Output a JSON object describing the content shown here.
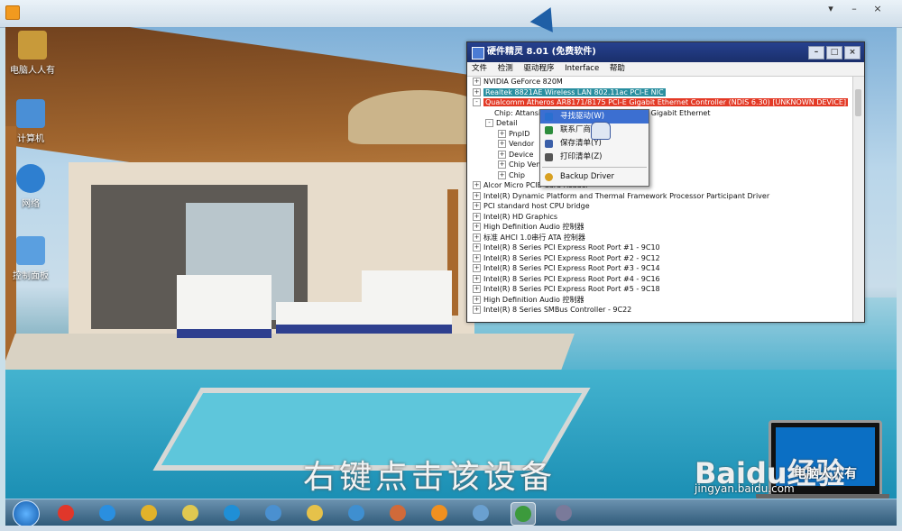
{
  "frame": {
    "controls": [
      "▾",
      "–",
      "×"
    ]
  },
  "desktop": {
    "icons": [
      {
        "label": "电脑人人有",
        "color": "#c89a3a"
      },
      {
        "label": "计算机",
        "color": "#4a8fd6"
      },
      {
        "label": "网络",
        "color": "#2e7fd0"
      },
      {
        "label": "控制面板",
        "color": "#5a9fe0"
      }
    ],
    "caption": "右键点击该设备"
  },
  "window": {
    "title": "硬件精灵 8.01 (免费软件)",
    "controls": [
      "–",
      "□",
      "×"
    ],
    "menu": [
      "文件",
      "检测",
      "驱动程序",
      "Interface",
      "帮助"
    ],
    "tree": [
      {
        "indent": 0,
        "toggle": "+",
        "text": "NVIDIA GeForce 820M",
        "style": ""
      },
      {
        "indent": 0,
        "toggle": "+",
        "text": "Realtek 8821AE Wireless LAN 802.11ac PCI-E NIC",
        "style": "teal"
      },
      {
        "indent": 0,
        "toggle": "-",
        "text": "Qualcomm Atheros AR8171/8175 PCI-E Gigabit Ethernet Controller (NDIS 6.30) [UNKNOWN DEVICE]",
        "style": "red"
      },
      {
        "indent": 1,
        "toggle": "",
        "text": "Chip: Attansic",
        "style": "",
        "tail": "1 Gigabit Ethernet"
      },
      {
        "indent": 1,
        "toggle": "-",
        "text": "Detail",
        "style": ""
      },
      {
        "indent": 2,
        "toggle": "+",
        "text": "PnpID",
        "style": ""
      },
      {
        "indent": 2,
        "toggle": "+",
        "text": "Vendor",
        "style": ""
      },
      {
        "indent": 2,
        "toggle": "+",
        "text": "Device",
        "style": ""
      },
      {
        "indent": 2,
        "toggle": "+",
        "text": "Chip Vend",
        "style": ""
      },
      {
        "indent": 2,
        "toggle": "+",
        "text": "Chip",
        "style": ""
      },
      {
        "indent": 0,
        "toggle": "+",
        "text": "Alcor Micro PCIE Card Reader",
        "style": ""
      },
      {
        "indent": 0,
        "toggle": "+",
        "text": "Intel(R) Dynamic Platform and Thermal Framework Processor Participant Driver",
        "style": ""
      },
      {
        "indent": 0,
        "toggle": "+",
        "text": "PCI standard host CPU bridge",
        "style": ""
      },
      {
        "indent": 0,
        "toggle": "+",
        "text": "Intel(R) HD Graphics",
        "style": ""
      },
      {
        "indent": 0,
        "toggle": "+",
        "text": "High Definition Audio 控制器",
        "style": ""
      },
      {
        "indent": 0,
        "toggle": "+",
        "text": "标准 AHCI 1.0串行 ATA 控制器",
        "style": ""
      },
      {
        "indent": 0,
        "toggle": "+",
        "text": "Intel(R) 8 Series PCI Express Root Port #1 - 9C10",
        "style": ""
      },
      {
        "indent": 0,
        "toggle": "+",
        "text": "Intel(R) 8 Series PCI Express Root Port #2 - 9C12",
        "style": ""
      },
      {
        "indent": 0,
        "toggle": "+",
        "text": "Intel(R) 8 Series PCI Express Root Port #3 - 9C14",
        "style": ""
      },
      {
        "indent": 0,
        "toggle": "+",
        "text": "Intel(R) 8 Series PCI Express Root Port #4 - 9C16",
        "style": ""
      },
      {
        "indent": 0,
        "toggle": "+",
        "text": "Intel(R) 8 Series PCI Express Root Port #5 - 9C18",
        "style": ""
      },
      {
        "indent": 0,
        "toggle": "+",
        "text": "High Definition Audio 控制器",
        "style": ""
      },
      {
        "indent": 0,
        "toggle": "+",
        "text": "Intel(R) 8 Series SMBus Controller - 9C22",
        "style": ""
      }
    ]
  },
  "context_menu": {
    "items": [
      {
        "label": "寻找驱动(W)",
        "icon": "#2a6fd0",
        "active": true
      },
      {
        "label": "联系厂商(",
        "icon": "#2c8c3c",
        "active": false
      },
      {
        "label": "保存清单(Y)",
        "icon": "#3a5fa8",
        "active": false
      },
      {
        "label": "打印清单(Z)",
        "icon": "#555555",
        "active": false
      }
    ],
    "extra": {
      "label": "Backup Driver",
      "icon": "#d8a020"
    }
  },
  "taskbar": {
    "apps": [
      {
        "name": "jiang-app",
        "color": "#e0372a"
      },
      {
        "name": "ie",
        "color": "#2a8fe0"
      },
      {
        "name": "chrome",
        "color": "#e2b22a"
      },
      {
        "name": "folder-green",
        "color": "#e0c850"
      },
      {
        "name": "browser",
        "color": "#1f8fd6"
      },
      {
        "name": "remote",
        "color": "#4a90d0"
      },
      {
        "name": "explorer",
        "color": "#e6c24a"
      },
      {
        "name": "fan",
        "color": "#3f8fd0"
      },
      {
        "name": "paint",
        "color": "#d06a3a"
      },
      {
        "name": "player",
        "color": "#f09020"
      },
      {
        "name": "notes",
        "color": "#6aa0d0"
      },
      {
        "name": "board",
        "color": "#3c9a3c"
      },
      {
        "name": "hw-tool",
        "color": "#7a7a9a"
      }
    ]
  },
  "watermark": {
    "brand": "Baidu",
    "brand2": "经验",
    "url": "jingyan.baidu.com",
    "tag": "电脑人人有"
  }
}
